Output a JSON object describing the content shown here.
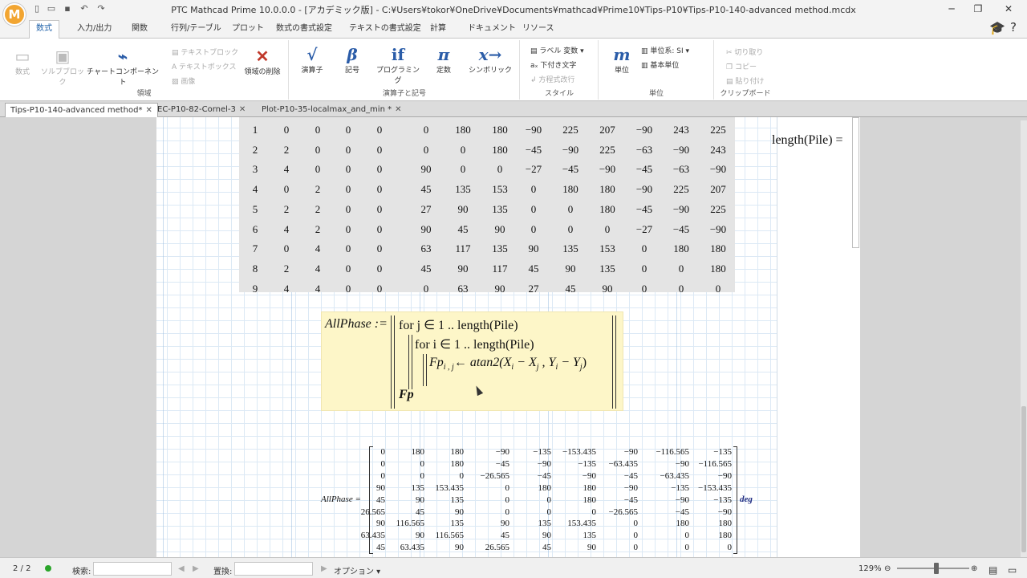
{
  "window": {
    "title": "PTC Mathcad Prime 10.0.0.0 - [アカデミック版] - C:¥Users¥tokor¥OneDrive¥Documents¥mathcad¥Prime10¥Tips-P10¥Tips-P10-140-advanced method.mcdx",
    "logo": "M"
  },
  "ribbon_tabs": [
    "数式",
    "入力/出力",
    "関数",
    "行列/テーブル",
    "プロット",
    "数式の書式設定",
    "テキストの書式設定",
    "計算",
    "ドキュメント",
    "リソース"
  ],
  "ribbon": {
    "region": {
      "label": "領域",
      "math": "数式",
      "solve_block": "ソルブブロック",
      "chart_component": "チャートコンポーネント",
      "text_block": "テキストブロック",
      "text_box": "テキストボックス",
      "image": "画像",
      "delete_region": "領域の削除"
    },
    "operators": {
      "label": "演算子と記号",
      "operators": "演算子",
      "symbols": "記号",
      "programming": "プログラミング",
      "constants": "定数",
      "symbolics": "シンボリック"
    },
    "style": {
      "label": "スタイル",
      "label_var": "ラベル 変数",
      "subscript": "下付き文字",
      "eq_break": "方程式改行"
    },
    "units": {
      "label": "単位",
      "units_btn": "単位",
      "unit_system": "単位系: SI",
      "base_units": "基本単位"
    },
    "clipboard": {
      "label": "クリップボード",
      "cut": "切り取り",
      "copy": "コピー",
      "paste": "貼り付け"
    }
  },
  "doc_tabs": [
    {
      "label": "Tips-P10-140-advanced method*",
      "active": true
    },
    {
      "label": "EC-P10-82-Cornel-3",
      "active": false
    },
    {
      "label": "Plot-P10-35-localmax_and_min *",
      "active": false
    }
  ],
  "matrix_table": [
    [
      "1",
      "0",
      "0",
      "0",
      "0",
      "0",
      "180",
      "180",
      "−90",
      "225",
      "207",
      "−90",
      "243",
      "225"
    ],
    [
      "2",
      "2",
      "0",
      "0",
      "0",
      "0",
      "0",
      "180",
      "−45",
      "−90",
      "225",
      "−63",
      "−90",
      "243"
    ],
    [
      "3",
      "4",
      "0",
      "0",
      "0",
      "90",
      "0",
      "0",
      "−27",
      "−45",
      "−90",
      "−45",
      "−63",
      "−90"
    ],
    [
      "4",
      "0",
      "2",
      "0",
      "0",
      "45",
      "135",
      "153",
      "0",
      "180",
      "180",
      "−90",
      "225",
      "207"
    ],
    [
      "5",
      "2",
      "2",
      "0",
      "0",
      "27",
      "90",
      "135",
      "0",
      "0",
      "180",
      "−45",
      "−90",
      "225"
    ],
    [
      "6",
      "4",
      "2",
      "0",
      "0",
      "90",
      "45",
      "90",
      "0",
      "0",
      "0",
      "−27",
      "−45",
      "−90"
    ],
    [
      "7",
      "0",
      "4",
      "0",
      "0",
      "63",
      "117",
      "135",
      "90",
      "135",
      "153",
      "0",
      "180",
      "180"
    ],
    [
      "8",
      "2",
      "4",
      "0",
      "0",
      "45",
      "90",
      "117",
      "45",
      "90",
      "135",
      "0",
      "0",
      "180"
    ],
    [
      "9",
      "4",
      "4",
      "0",
      "0",
      "0",
      "63",
      "90",
      "27",
      "45",
      "90",
      "0",
      "0",
      "0"
    ]
  ],
  "length_eval": "length(Pile) =",
  "program": {
    "lhs": "AllPhase :=",
    "line1": "for j ∈ 1 .. length(Pile)",
    "line2": "for i ∈ 1 .. length(Pile)",
    "line3_lhs": "Fp",
    "line3_sub": "i , j",
    "line3_rhs": "← atan2(X",
    "line3_xi": "i",
    "line3_mid": " − X",
    "line3_xj": "j",
    "line3_y": " , Y",
    "line3_yi": "i",
    "line3_mid2": " − Y",
    "line3_yj": "j",
    "line3_end": ")",
    "return": "Fp"
  },
  "result": {
    "lhs": "AllPhase =",
    "unit": "deg",
    "rows": [
      [
        "0",
        "180",
        "180",
        "−90",
        "−135",
        "−153.435",
        "−90",
        "−116.565",
        "−135"
      ],
      [
        "0",
        "0",
        "180",
        "−45",
        "−90",
        "−135",
        "−63.435",
        "−90",
        "−116.565"
      ],
      [
        "0",
        "0",
        "0",
        "−26.565",
        "−45",
        "−90",
        "−45",
        "−63.435",
        "−90"
      ],
      [
        "90",
        "135",
        "153.435",
        "0",
        "180",
        "180",
        "−90",
        "−135",
        "−153.435"
      ],
      [
        "45",
        "90",
        "135",
        "0",
        "0",
        "180",
        "−45",
        "−90",
        "−135"
      ],
      [
        "26.565",
        "45",
        "90",
        "0",
        "0",
        "0",
        "−26.565",
        "−45",
        "−90"
      ],
      [
        "90",
        "116.565",
        "135",
        "90",
        "135",
        "153.435",
        "0",
        "180",
        "180"
      ],
      [
        "63.435",
        "90",
        "116.565",
        "45",
        "90",
        "135",
        "0",
        "0",
        "180"
      ],
      [
        "45",
        "63.435",
        "90",
        "26.565",
        "45",
        "90",
        "0",
        "0",
        "0"
      ]
    ]
  },
  "status": {
    "page": "2 / 2",
    "search_label": "検索:",
    "replace_label": "置換:",
    "options": "オプション",
    "zoom": "129%"
  }
}
